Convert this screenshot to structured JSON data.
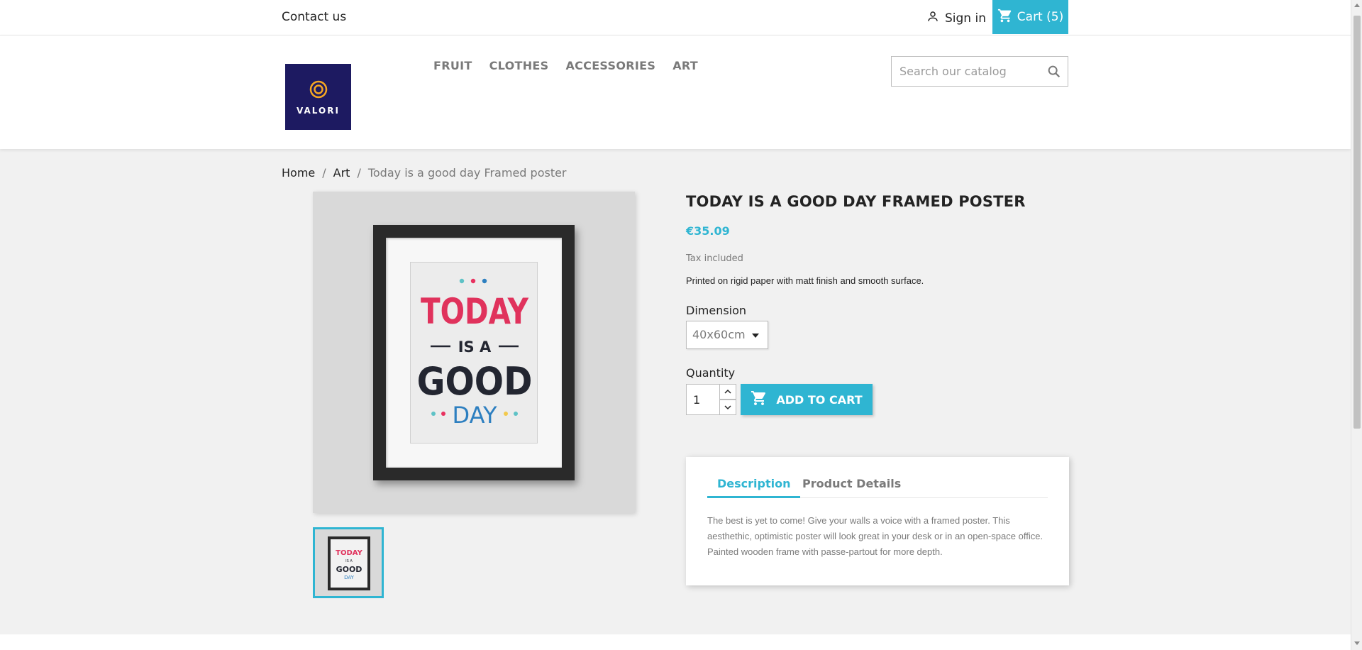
{
  "colors": {
    "accent": "#2fb5d2",
    "logo_bg": "#1d1a61",
    "logo_ring": "#f5a623"
  },
  "topnav": {
    "contact": "Contact us",
    "signin": "Sign in",
    "cart": "Cart (5)",
    "user_icon": "user-icon",
    "cart_icon": "cart-icon"
  },
  "header": {
    "logo_text": "VALORI",
    "menu": [
      "FRUIT",
      "CLOTHES",
      "ACCESSORIES",
      "ART"
    ],
    "search": {
      "placeholder": "Search our catalog",
      "icon": "search-icon"
    }
  },
  "breadcrumb": {
    "items": [
      "Home",
      "Art",
      "Today is a good day Framed poster"
    ],
    "separator": "/"
  },
  "product": {
    "title": "TODAY IS A GOOD DAY FRAMED POSTER",
    "price": "€35.09",
    "tax": "Tax included",
    "short_description": "Printed on rigid paper with matt finish and smooth surface.",
    "dimension_label": "Dimension",
    "dimension_value": "40x60cm",
    "quantity_label": "Quantity",
    "quantity_value": "1",
    "add_to_cart": "ADD TO CART",
    "poster": {
      "line1": "TODAY",
      "line2": "IS A",
      "line3": "GOOD",
      "line4": "DAY"
    }
  },
  "tabs": {
    "items": [
      "Description",
      "Product Details"
    ],
    "active": "Description",
    "description": "The best is yet to come! Give your walls a voice with a framed poster. This aesthethic, optimistic poster will look great in your desk or in an open-space office. Painted wooden frame with passe-partout for more depth."
  }
}
